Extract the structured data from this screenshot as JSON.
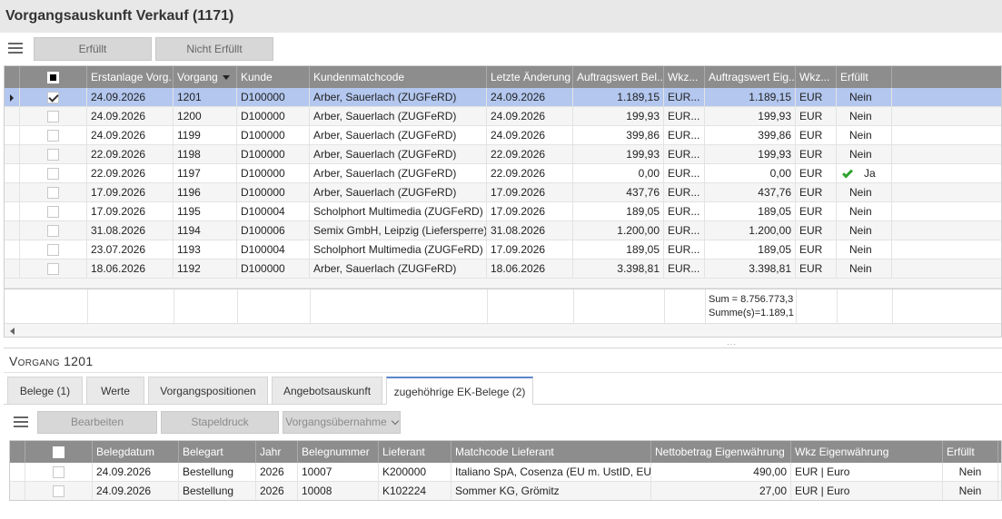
{
  "window": {
    "title": "Vorgangsauskunft Verkauf (1171)"
  },
  "toolbar_top": {
    "fulfilled_label": "Erfüllt",
    "not_fulfilled_label": "Nicht Erfüllt"
  },
  "main_grid": {
    "columns": [
      "Erstanlage Vorg...",
      "Vorgang",
      "Kunde",
      "Kundenmatchcode",
      "Letzte Änderung",
      "Auftragswert Bel...",
      "Wkz...",
      "Auftragswert Eig...",
      "Wkz...",
      "Erfüllt"
    ],
    "rows": [
      {
        "checked": true,
        "date": "24.09.2026",
        "vorgang": "1201",
        "kunde": "D100000",
        "match": "Arber, Sauerlach (ZUGFeRD)",
        "changed": "24.09.2026",
        "wert_bel": "1.189,15",
        "wkz1": "EUR...",
        "wert_eig": "1.189,15",
        "wkz2": "EUR",
        "erfuellt": "Nein",
        "ok": false
      },
      {
        "checked": false,
        "date": "24.09.2026",
        "vorgang": "1200",
        "kunde": "D100000",
        "match": "Arber, Sauerlach (ZUGFeRD)",
        "changed": "24.09.2026",
        "wert_bel": "199,93",
        "wkz1": "EUR...",
        "wert_eig": "199,93",
        "wkz2": "EUR",
        "erfuellt": "Nein",
        "ok": false
      },
      {
        "checked": false,
        "date": "24.09.2026",
        "vorgang": "1199",
        "kunde": "D100000",
        "match": "Arber, Sauerlach (ZUGFeRD)",
        "changed": "24.09.2026",
        "wert_bel": "399,86",
        "wkz1": "EUR...",
        "wert_eig": "399,86",
        "wkz2": "EUR",
        "erfuellt": "Nein",
        "ok": false
      },
      {
        "checked": false,
        "date": "22.09.2026",
        "vorgang": "1198",
        "kunde": "D100000",
        "match": "Arber, Sauerlach (ZUGFeRD)",
        "changed": "22.09.2026",
        "wert_bel": "199,93",
        "wkz1": "EUR...",
        "wert_eig": "199,93",
        "wkz2": "EUR",
        "erfuellt": "Nein",
        "ok": false
      },
      {
        "checked": false,
        "date": "22.09.2026",
        "vorgang": "1197",
        "kunde": "D100000",
        "match": "Arber, Sauerlach (ZUGFeRD)",
        "changed": "22.09.2026",
        "wert_bel": "0,00",
        "wkz1": "EUR...",
        "wert_eig": "0,00",
        "wkz2": "EUR",
        "erfuellt": "Ja",
        "ok": true
      },
      {
        "checked": false,
        "date": "17.09.2026",
        "vorgang": "1196",
        "kunde": "D100000",
        "match": "Arber, Sauerlach (ZUGFeRD)",
        "changed": "17.09.2026",
        "wert_bel": "437,76",
        "wkz1": "EUR...",
        "wert_eig": "437,76",
        "wkz2": "EUR",
        "erfuellt": "Nein",
        "ok": false
      },
      {
        "checked": false,
        "date": "17.09.2026",
        "vorgang": "1195",
        "kunde": "D100004",
        "match": "Scholphort Multimedia (ZUGFeRD)",
        "changed": "17.09.2026",
        "wert_bel": "189,05",
        "wkz1": "EUR...",
        "wert_eig": "189,05",
        "wkz2": "EUR",
        "erfuellt": "Nein",
        "ok": false
      },
      {
        "checked": false,
        "date": "31.08.2026",
        "vorgang": "1194",
        "kunde": "D100006",
        "match": "Semix GmbH, Leipzig (Liefersperre)",
        "changed": "31.08.2026",
        "wert_bel": "1.200,00",
        "wkz1": "EUR...",
        "wert_eig": "1.200,00",
        "wkz2": "EUR",
        "erfuellt": "Nein",
        "ok": false
      },
      {
        "checked": false,
        "date": "23.07.2026",
        "vorgang": "1193",
        "kunde": "D100004",
        "match": "Scholphort Multimedia (ZUGFeRD)",
        "changed": "17.09.2026",
        "wert_bel": "189,05",
        "wkz1": "EUR...",
        "wert_eig": "189,05",
        "wkz2": "EUR",
        "erfuellt": "Nein",
        "ok": false
      },
      {
        "checked": false,
        "date": "18.06.2026",
        "vorgang": "1192",
        "kunde": "D100000",
        "match": "Arber, Sauerlach (ZUGFeRD)",
        "changed": "18.06.2026",
        "wert_bel": "3.398,81",
        "wkz1": "EUR...",
        "wert_eig": "3.398,81",
        "wkz2": "EUR",
        "erfuellt": "Nein",
        "ok": false
      }
    ],
    "summary": {
      "sum": "Sum = 8.756.773,3",
      "sum_selected": "Summe(s)=1.189,1"
    }
  },
  "detail": {
    "title": "Vorgang 1201",
    "tabs": [
      "Belege (1)",
      "Werte",
      "Vorgangspositionen",
      "Angebotsauskunft",
      "zugehöhrige EK-Belege (2)"
    ],
    "active_tab": 4,
    "toolbar": {
      "edit_label": "Bearbeiten",
      "batch_print_label": "Stapeldruck",
      "takeover_label": "Vorgangsübernahme"
    },
    "grid": {
      "columns": [
        "Belegdatum",
        "Belegart",
        "Jahr",
        "Belegnummer",
        "Lieferant",
        "Matchcode Lieferant",
        "Nettobetrag Eigenwährung",
        "Wkz Eigenwährung",
        "Erfüllt"
      ],
      "rows": [
        {
          "date": "24.09.2026",
          "art": "Bestellung",
          "jahr": "2026",
          "nummer": "10007",
          "lieferant": "K200000",
          "match": "Italiano SpA, Cosenza (EU m. UstID, EUR)",
          "netto": "490,00",
          "wkz": "EUR  |  Euro",
          "erfuellt": "Nein"
        },
        {
          "date": "24.09.2026",
          "art": "Bestellung",
          "jahr": "2026",
          "nummer": "10008",
          "lieferant": "K102224",
          "match": "Sommer KG, Grömitz",
          "netto": "27,00",
          "wkz": "EUR  |  Euro",
          "erfuellt": "Nein"
        }
      ]
    }
  }
}
